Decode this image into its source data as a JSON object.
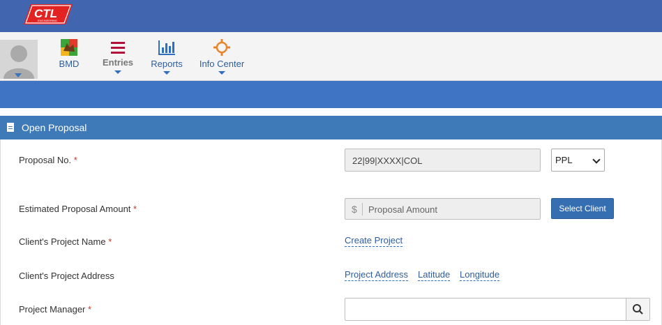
{
  "header": {
    "logo_text": "CTL",
    "logo_sub": "ENGINEERING"
  },
  "nav": {
    "items": [
      {
        "label": "BMD",
        "icon": "bmd-app-icon",
        "dropdown": false
      },
      {
        "label": "Entries",
        "icon": "hamburger-list-icon",
        "dropdown": true
      },
      {
        "label": "Reports",
        "icon": "bar-chart-icon",
        "dropdown": true
      },
      {
        "label": "Info Center",
        "icon": "crosshair-target-icon",
        "dropdown": true
      }
    ]
  },
  "panel": {
    "title": "Open Proposal",
    "fields": {
      "proposal_no": {
        "label": "Proposal No.",
        "value": "22|99|XXXX|COL",
        "type_select": "PPL"
      },
      "amount": {
        "label": "Estimated Proposal Amount",
        "prefix": "$",
        "placeholder": "Proposal Amount",
        "button": "Select Client"
      },
      "project_name": {
        "label": "Client's Project Name",
        "link": "Create Project"
      },
      "project_address": {
        "label": "Client's Project Address",
        "links": [
          "Project Address",
          "Latitude",
          "Longitude"
        ]
      },
      "project_manager": {
        "label": "Project Manager",
        "value": ""
      }
    },
    "required_mark": "*"
  },
  "colors": {
    "topbar": "#4265b0",
    "band": "#3f73c4",
    "panel_head": "#3e7ab8",
    "link": "#2e5d9f",
    "required": "#c0392b"
  }
}
